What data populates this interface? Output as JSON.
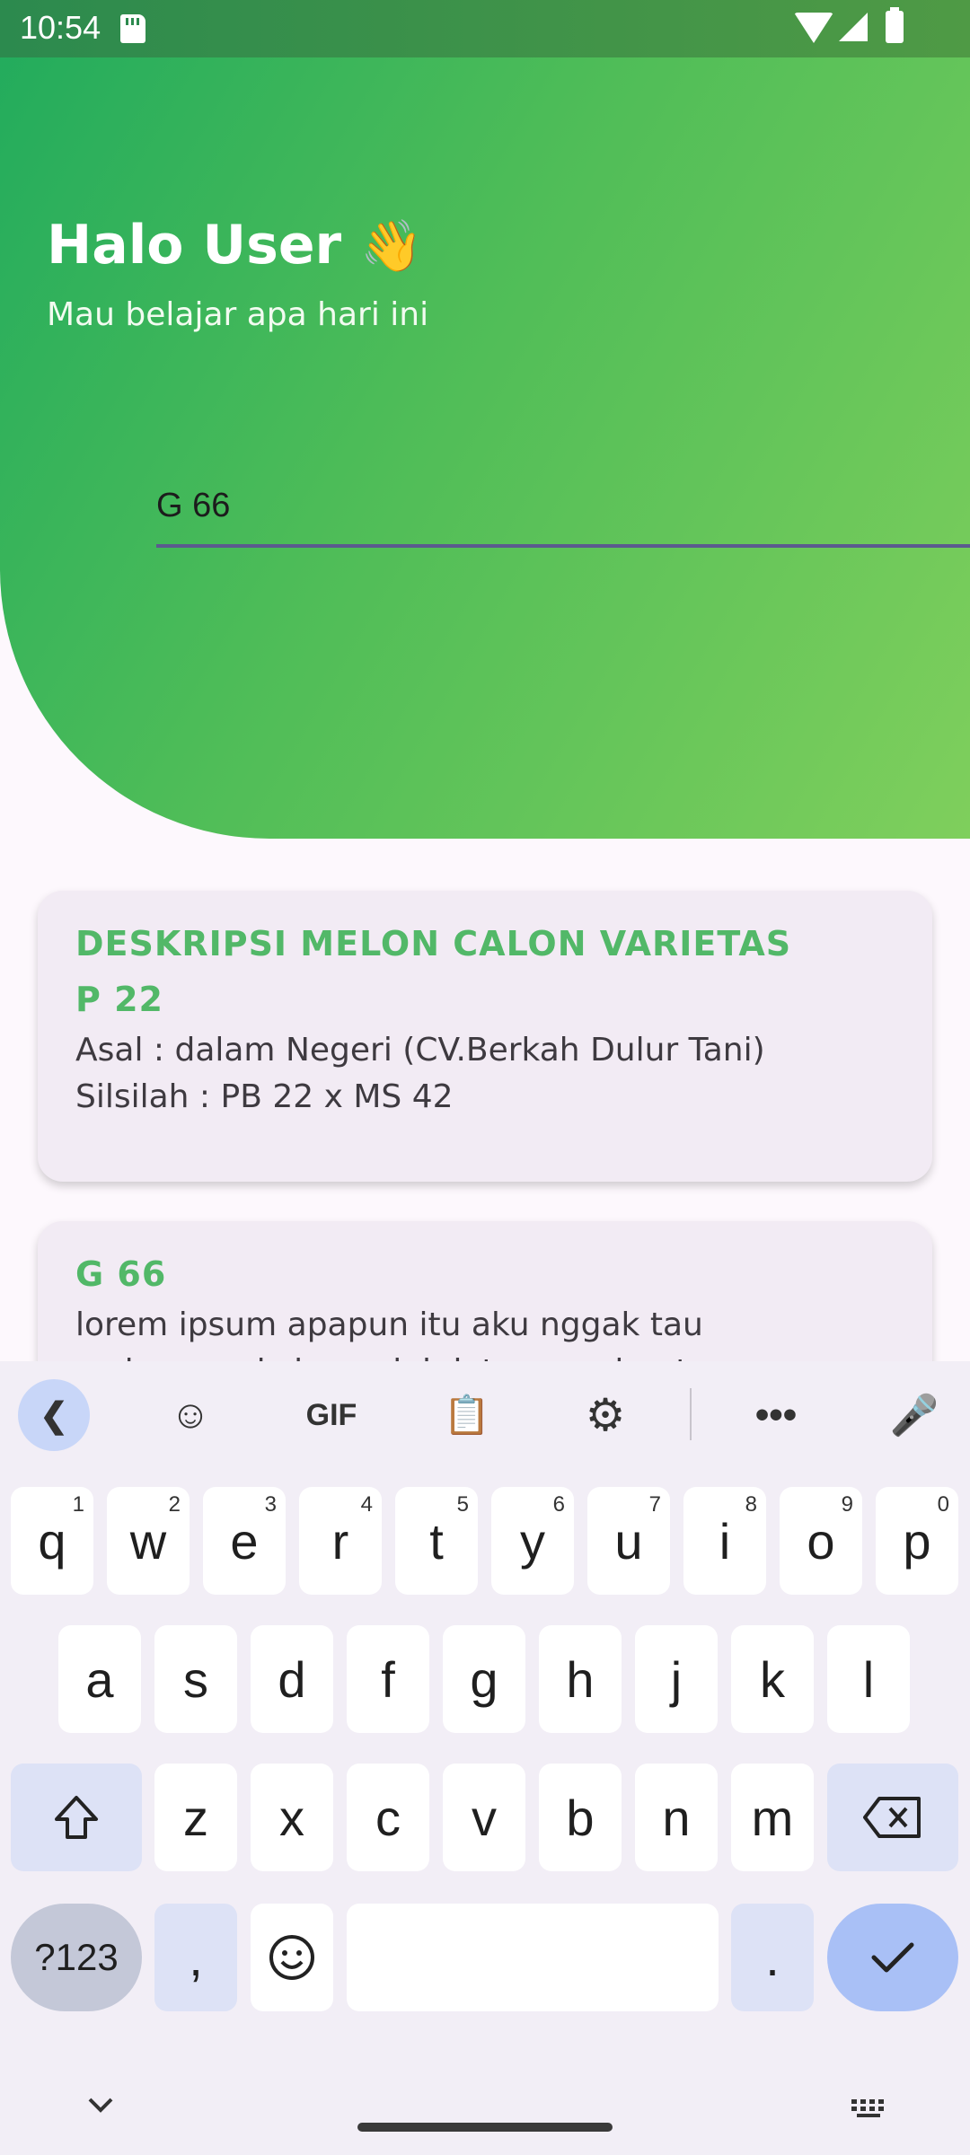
{
  "status_bar": {
    "time": "10:54",
    "icons": [
      "sd-card-icon",
      "wifi-icon",
      "signal-icon",
      "battery-icon"
    ]
  },
  "header": {
    "greeting": "Halo User",
    "wave_emoji": "👋",
    "subtitle": "Mau belajar apa hari ini",
    "gradient_colors": [
      "#21ab5d",
      "#7fcf5c"
    ]
  },
  "search": {
    "value": "G 66",
    "underline_color": "#5b5a8e"
  },
  "cards": [
    {
      "title": "DESKRIPSI MELON CALON VARIETAS P 22",
      "lines": [
        "Asal : dalam Negeri (CV.Berkah Dulur Tani)",
        "Silsilah : PB 22 x MS 42"
      ]
    },
    {
      "title": "G 66",
      "lines": [
        "lorem ipsum apapun itu aku nggak tau",
        "ya bang pokok nya ini data yang buat"
      ]
    }
  ],
  "keyboard": {
    "toolbar": {
      "gif_label": "GIF",
      "icons": [
        "back-chevron-icon",
        "sticker-icon",
        "clipboard-icon",
        "settings-icon",
        "more-icon",
        "mic-icon"
      ]
    },
    "row1": [
      {
        "key": "q",
        "hint": "1"
      },
      {
        "key": "w",
        "hint": "2"
      },
      {
        "key": "e",
        "hint": "3"
      },
      {
        "key": "r",
        "hint": "4"
      },
      {
        "key": "t",
        "hint": "5"
      },
      {
        "key": "y",
        "hint": "6"
      },
      {
        "key": "u",
        "hint": "7"
      },
      {
        "key": "i",
        "hint": "8"
      },
      {
        "key": "o",
        "hint": "9"
      },
      {
        "key": "p",
        "hint": "0"
      }
    ],
    "row2": [
      "a",
      "s",
      "d",
      "f",
      "g",
      "h",
      "j",
      "k",
      "l"
    ],
    "row3": [
      "z",
      "x",
      "c",
      "v",
      "b",
      "n",
      "m"
    ],
    "row4": {
      "symbols_label": "?123",
      "comma": ",",
      "period": "."
    },
    "accent_color": "#a9c0f6"
  }
}
